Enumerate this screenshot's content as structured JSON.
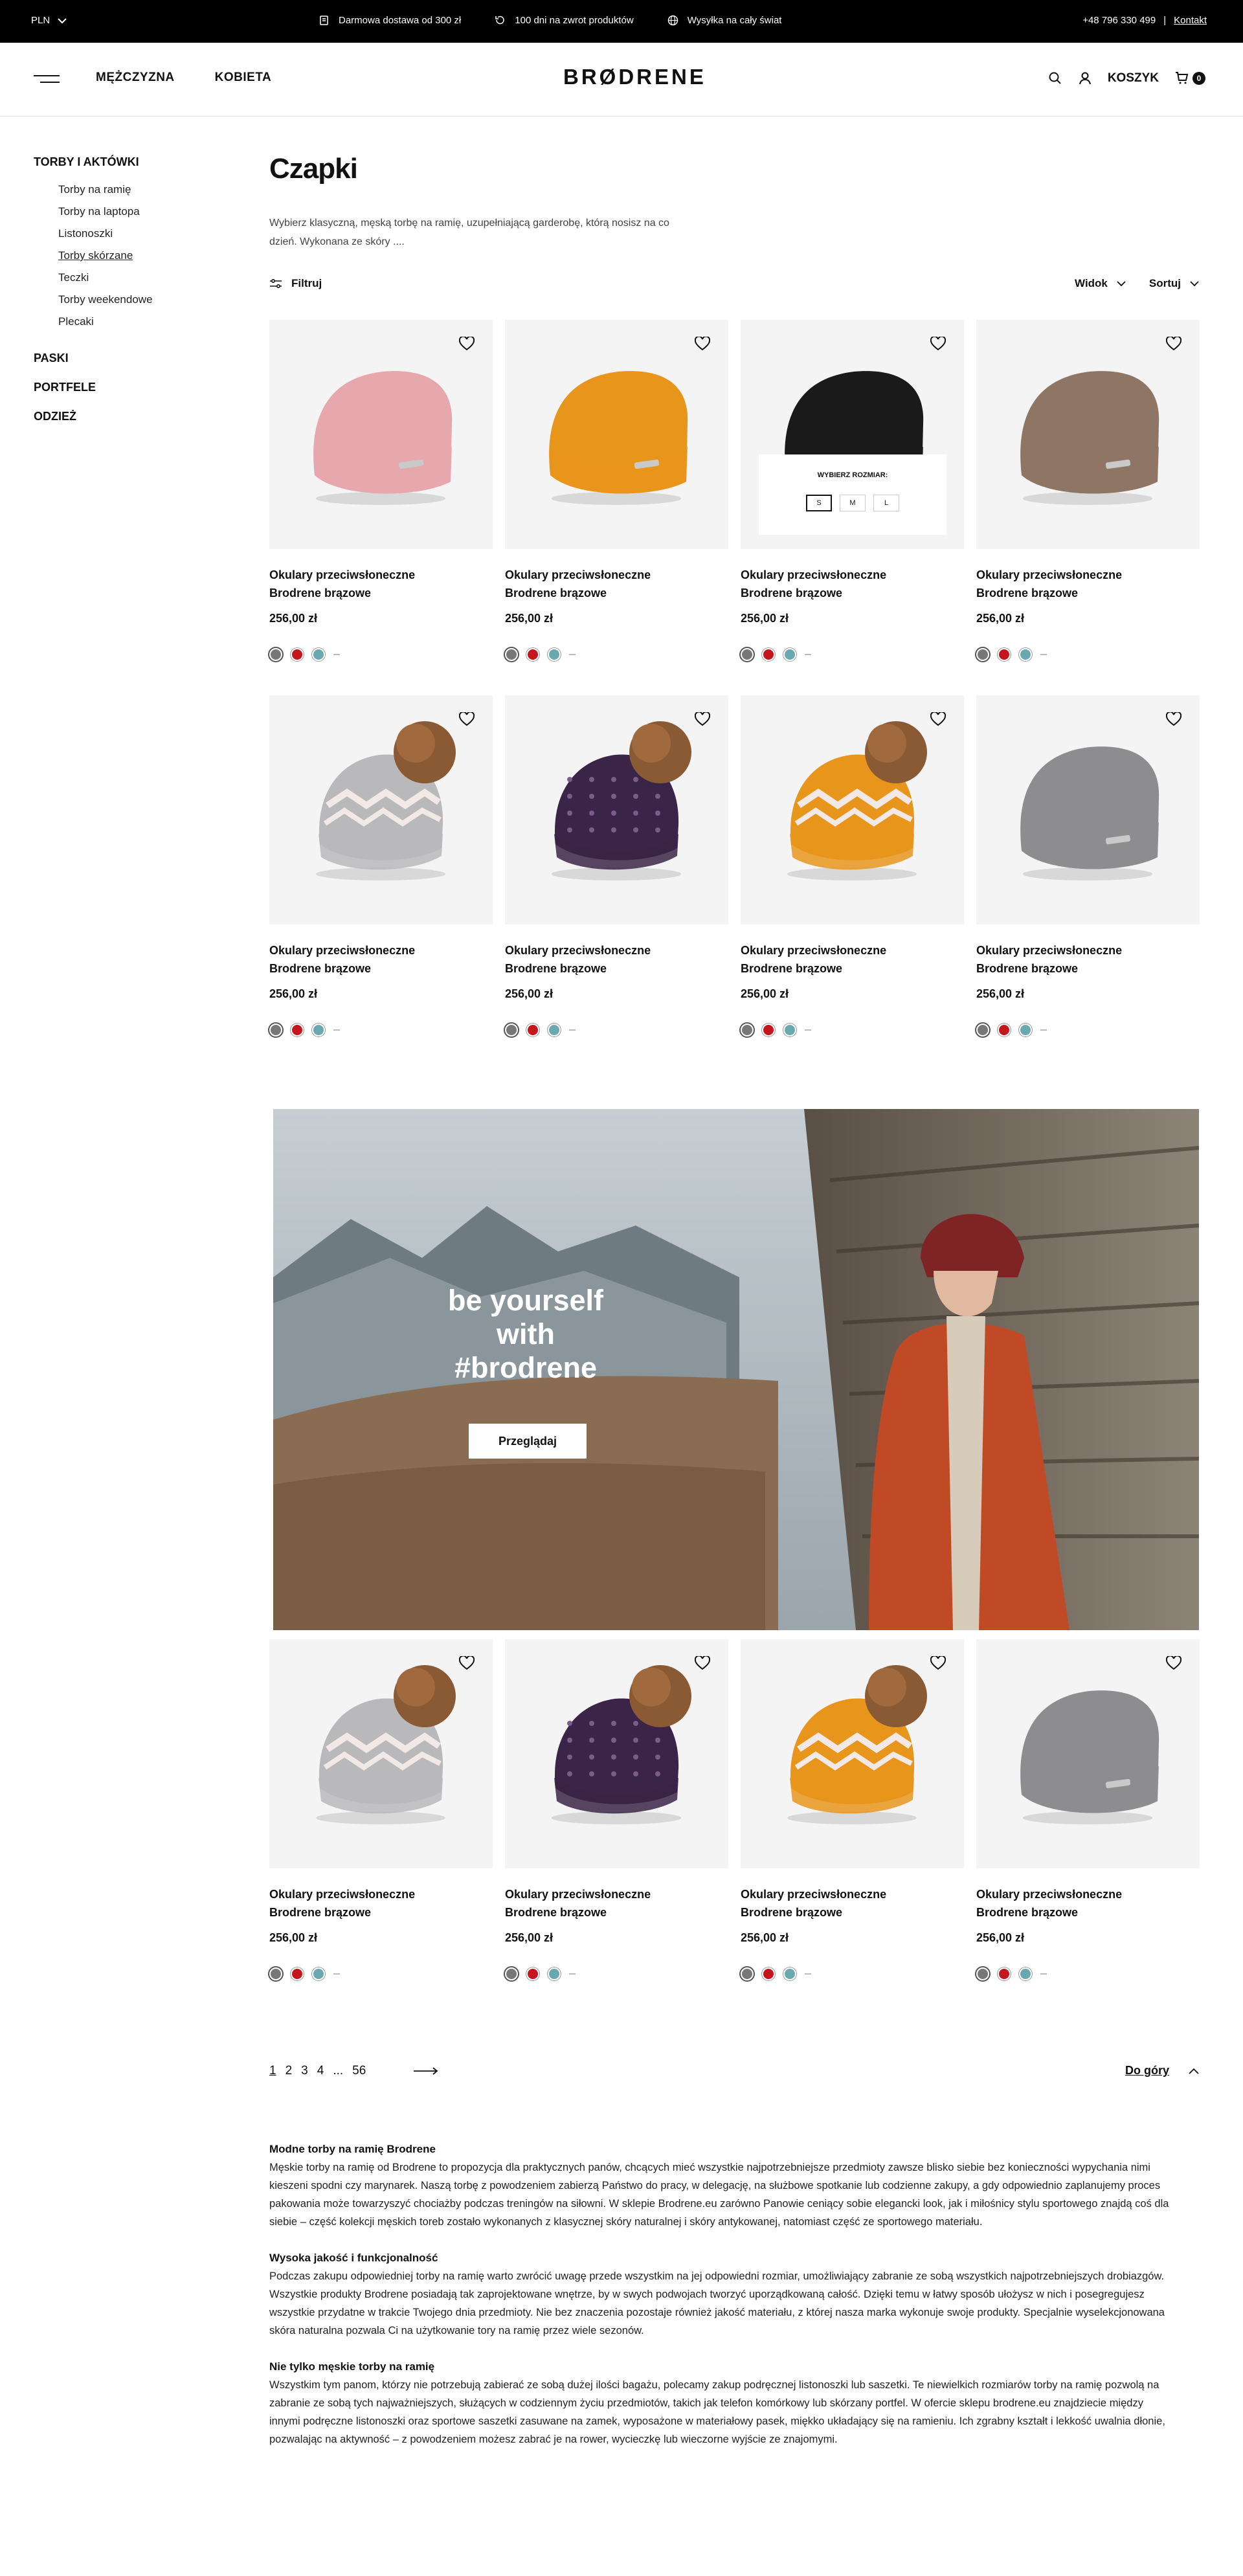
{
  "topbar": {
    "currency": "PLN",
    "promos": [
      {
        "icon": "truck-icon",
        "text": "Darmowa dostawa od 300 zł"
      },
      {
        "icon": "return-icon",
        "text": "100 dni na zwrot produktów"
      },
      {
        "icon": "globe-icon",
        "text": "Wysyłka na cały świat"
      }
    ],
    "phone": "+48 796 330 499",
    "separator": "|",
    "contact": "Kontakt"
  },
  "header": {
    "nav": [
      "MĘŻCZYZNA",
      "KOBIETA"
    ],
    "logo": "BRØDRENE",
    "cart_label": "KOSZYK",
    "cart_count": "0"
  },
  "sidebar": {
    "categories": [
      {
        "label": "TORBY I AKTÓWKI",
        "items": [
          "Torby na ramię",
          "Torby na laptopa",
          "Listonoszki",
          "Torby skórzane",
          "Teczki",
          "Torby weekendowe",
          "Plecaki"
        ],
        "active": 3
      },
      {
        "label": "PASKI"
      },
      {
        "label": "PORTFELE"
      },
      {
        "label": "ODZIEŻ"
      }
    ]
  },
  "page": {
    "title": "Czapki",
    "intro": "Wybierz klasyczną, męską torbę na ramię, uzupełniającą garderobę, którą nosisz na co dzień. Wykonana ze skóry ....",
    "filter_label": "Filtruj",
    "view_label": "Widok",
    "sort_label": "Sortuj"
  },
  "product": {
    "name_line1": "Okulary przeciwsłoneczne",
    "name_line2": "Brodrene brązowe",
    "price": "256,00 zł",
    "swatch_colors": [
      "#777777",
      "#c4161c",
      "#6aa8b0"
    ]
  },
  "size_picker": {
    "title": "WYBIERZ ROZMIAR:",
    "sizes": [
      "S",
      "M",
      "L"
    ]
  },
  "banner": {
    "line1": "be yourself",
    "line2": "with #brodrene",
    "button": "Przeglądaj"
  },
  "pagination": {
    "pages": [
      "1",
      "2",
      "3",
      "4",
      "...",
      "56"
    ],
    "back_to_top": "Do góry"
  },
  "seo": [
    {
      "heading": "Modne torby na ramię Brodrene",
      "text": "Męskie torby na ramię od Brodrene to propozycja dla praktycznych panów, chcących mieć wszystkie najpotrzebniejsze przedmioty zawsze blisko siebie bez konieczności wypychania nimi kieszeni spodni czy marynarek. Naszą torbę z powodzeniem zabierzą Państwo do pracy, w delegację, na służbowe spotkanie lub codzienne zakupy, a gdy odpowiednio zaplanujemy proces pakowania może towarzyszyć chociażby podczas treningów na siłowni. W sklepie Brodrene.eu zarówno Panowie ceniący sobie elegancki look, jak i miłośnicy stylu sportowego znajdą coś dla siebie – część kolekcji męskich toreb zostało wykonanych z klasycznej skóry naturalnej i skóry antykowanej, natomiast część ze sportowego materiału."
    },
    {
      "heading": "Wysoka jakość i funkcjonalność",
      "text": "Podczas zakupu odpowiedniej torby na ramię warto zwrócić uwagę przede wszystkim na jej odpowiedni rozmiar, umożliwiający zabranie ze sobą wszystkich najpotrzebniejszych drobiazgów. Wszystkie produkty Brodrene posiadają tak zaprojektowane wnętrze, by w swych podwojach tworzyć uporządkowaną całość. Dzięki temu w łatwy sposób ułożysz w nich i posegregujesz wszystkie przydatne w trakcie Twojego dnia przedmioty. Nie bez znaczenia pozostaje również jakość materiału, z której nasza marka wykonuje swoje produkty. Specjalnie wyselekcjonowana skóra naturalna pozwala Ci na użytkowanie tory na ramię przez wiele sezonów."
    },
    {
      "heading": "Nie tylko męskie torby na ramię",
      "text": "Wszystkim tym panom, którzy nie potrzebują zabierać ze sobą dużej ilości bagażu, polecamy zakup podręcznej listonoszki lub saszetki. Te niewielkich rozmiarów torby na ramię pozwolą na zabranie ze sobą tych najważniejszych, służących w codziennym życiu przedmiotów, takich jak telefon komórkowy lub skórzany portfel. W ofercie sklepu brodrene.eu znajdziecie między innymi podręczne listonoszki oraz sportowe saszetki zasuwane na zamek, wyposażone w materiałowy pasek, miękko układający się na ramieniu. Ich zgrabny kształt i lekkość uwalnia dłonie, pozwalając na aktywność – z powodzeniem możesz zabrać je na rower, wycieczkę lub wieczorne wyjście ze znajomymi."
    }
  ],
  "colors": {
    "topbar_bg": "#000000",
    "card_bg": "#f4f4f4",
    "hat_colors": [
      "#e6a7ad",
      "#e8951c",
      "#1a1a1a",
      "#8f7564",
      "#b9b9bb",
      "#3a2447",
      "#e8951c",
      "#8d8d8f"
    ]
  }
}
